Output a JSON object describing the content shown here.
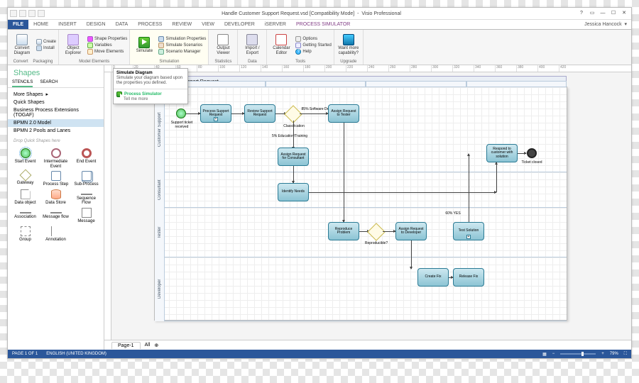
{
  "titlebar": {
    "doc": "Handle Customer Support Request.vsd  [Compatibility Mode]",
    "app": "Visio Professional",
    "user": "Jessica Hancock"
  },
  "tabs": {
    "file": "FILE",
    "items": [
      "HOME",
      "INSERT",
      "DESIGN",
      "DATA",
      "PROCESS",
      "REVIEW",
      "VIEW",
      "DEVELOPER",
      "iSERVER"
    ],
    "active": "PROCESS SIMULATOR"
  },
  "ribbon": {
    "convert": {
      "label": "Convert",
      "convert_diagram": "Convert Diagram",
      "create": "Create",
      "install": "Install",
      "packaging_label": "Packaging",
      "object_explorer": "Object Explorer",
      "model_elements_label": "Model Elements",
      "shape_properties": "Shape Properties",
      "variables": "Variables",
      "move_elements": "Move Elements"
    },
    "simulation": {
      "label": "Simulation",
      "simulate": "Simulate",
      "sim_props": "Simulation Properties",
      "sim_scen": "Simulate Scenarios",
      "scen_mgr": "Scenario Manager"
    },
    "statistics": {
      "label": "Statistics",
      "output_viewer": "Output Viewer"
    },
    "data": {
      "label": "Data",
      "import_export": "Import / Export"
    },
    "tools": {
      "label": "Tools",
      "cal": "Calendar Editor",
      "options": "Options",
      "getting_started": "Getting Started",
      "help": "Help"
    },
    "upgrade": {
      "label": "Upgrade",
      "want_more": "Want more capability?"
    }
  },
  "tooltip": {
    "title": "Simulate Diagram",
    "body": "Simulate your diagram based upon the properties you defined.",
    "ps": "Process Simulator",
    "tm": "Tell me more"
  },
  "side": {
    "heading": "Shapes",
    "tabs": {
      "stencils": "STENCILS",
      "search": "SEARCH"
    },
    "list": {
      "more": "More Shapes",
      "quick": "Quick Shapes",
      "bpe": "Business Process Extensions (TOGAF)",
      "bpmn20": "BPMN 2.0 Model",
      "pools": "BPMN 2 Pools and Lanes"
    },
    "drop_hint": "Drop Quick Shapes here",
    "shapes": {
      "start_event": "Start Event",
      "intermediate_event": "Intermediate Event",
      "end_event": "End Event",
      "gateway": "Gateway",
      "process_step": "Process Step",
      "sub_process": "Sub-Process",
      "data_object": "Data object",
      "data_store": "Data Store",
      "sequence_flow": "Sequence Flow",
      "association": "Association",
      "message_flow": "Message flow",
      "message": "Message",
      "group": "Group",
      "annotation": "Annotation"
    }
  },
  "canvas": {
    "pool_title": "Customer Support Request",
    "lanes": {
      "cs": "Customer Support",
      "con": "Consultant",
      "test": "Tester",
      "dev": "Developer"
    },
    "swim": {
      "a": "",
      "b": "",
      "c": "",
      "d": ""
    },
    "tasks": {
      "start_label": "Support ticket received",
      "process": "Process Support Request",
      "review": "Review Support Request",
      "class_label": "Classification",
      "class_edge1": "85% Software Defect",
      "class_edge2": "5% Education/Training",
      "assign_tester": "Assign Request to Tester",
      "assign_consultant": "Assign Request for Consultant",
      "identify": "Identify Needs",
      "reproduce": "Reproduce Problem",
      "rep_gw": "Reproducible?",
      "rep_yes": "60% YES",
      "assign_dev": "Assign Request to Developer",
      "test_sol": "Test Solution",
      "create_fix": "Create Fix",
      "release_fix": "Release Fix",
      "respond": "Respond to customer with solution",
      "end_label": "Ticket closed"
    }
  },
  "pagetabs": {
    "p1": "Page-1",
    "all": "All"
  },
  "status": {
    "page": "PAGE 1 OF 1",
    "lang": "ENGLISH (UNITED KINGDOM)",
    "zoom": "79%"
  }
}
